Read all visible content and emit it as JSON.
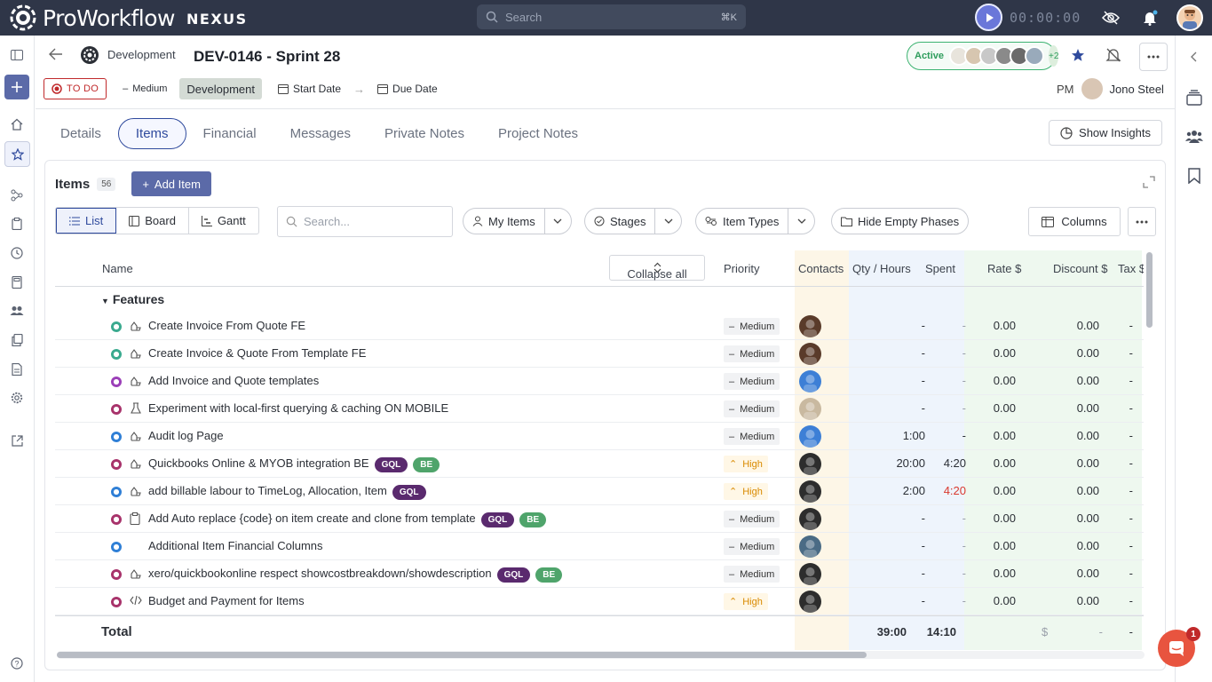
{
  "app": {
    "brand": "ProWorkflow",
    "product": "NEXUS"
  },
  "search": {
    "placeholder": "Search",
    "shortcut": "⌘K"
  },
  "timer": {
    "time": "00:00:00"
  },
  "project": {
    "breadcrumb": "Development",
    "title": "DEV-0146 - Sprint 28",
    "status": "Active",
    "status_extra": "+2",
    "state": "TO DO",
    "priority": "Medium",
    "stage": "Development",
    "start_label": "Start Date",
    "due_label": "Due Date",
    "pm_label": "PM",
    "pm_name": "Jono Steel"
  },
  "tabs": [
    "Details",
    "Items",
    "Financial",
    "Messages",
    "Private Notes",
    "Project Notes"
  ],
  "active_tab": "Items",
  "insights_label": "Show Insights",
  "items": {
    "title": "Items",
    "count": "56",
    "add_label": "Add Item",
    "views": [
      "List",
      "Board",
      "Gantt"
    ],
    "search_placeholder": "Search...",
    "filters": {
      "my_items": "My Items",
      "stages": "Stages",
      "item_types": "Item Types",
      "hide_empty": "Hide Empty Phases"
    },
    "columns_label": "Columns",
    "collapse_label": "Collapse all"
  },
  "table": {
    "headers": {
      "name": "Name",
      "priority": "Priority",
      "contacts": "Contacts",
      "qty": "Qty / Hours",
      "spent": "Spent",
      "rate": "Rate $",
      "discount": "Discount $",
      "tax": "Tax $"
    },
    "section": "Features",
    "rows": [
      {
        "name": "Create Invoice From Quote FE",
        "status_color": "#3aaa8f",
        "type_icon": "feature-icon",
        "tags": [],
        "priority": "Medium",
        "qty": "-",
        "spent": "-",
        "spent_style": "muted",
        "rate": "0.00",
        "discount": "0.00",
        "tax": "-",
        "avatar_color": "#5a3b2a"
      },
      {
        "name": "Create Invoice & Quote From Template FE",
        "status_color": "#3aaa8f",
        "type_icon": "feature-icon",
        "tags": [],
        "priority": "Medium",
        "qty": "-",
        "spent": "-",
        "spent_style": "muted",
        "rate": "0.00",
        "discount": "0.00",
        "tax": "-",
        "avatar_color": "#5a3b2a"
      },
      {
        "name": "Add Invoice and Quote templates",
        "status_color": "#9b3fb8",
        "type_icon": "feature-icon",
        "tags": [],
        "priority": "Medium",
        "qty": "-",
        "spent": "-",
        "spent_style": "muted",
        "rate": "0.00",
        "discount": "0.00",
        "tax": "-",
        "avatar_color": "#3d7fd6"
      },
      {
        "name": "Experiment with local-first querying & caching ON MOBILE",
        "status_color": "#a8336b",
        "type_icon": "flask-icon",
        "tags": [],
        "priority": "Medium",
        "qty": "-",
        "spent": "-",
        "spent_style": "muted",
        "rate": "0.00",
        "discount": "0.00",
        "tax": "-",
        "avatar_color": "#c9b9a0"
      },
      {
        "name": "Audit log Page",
        "status_color": "#2f7fd6",
        "type_icon": "feature-icon",
        "tags": [],
        "priority": "Medium",
        "qty": "1:00",
        "spent": "-",
        "spent_style": "normal",
        "rate": "0.00",
        "discount": "0.00",
        "tax": "-",
        "avatar_color": "#3d7fd6"
      },
      {
        "name": "Quickbooks Online & MYOB integration BE",
        "status_color": "#a8336b",
        "type_icon": "feature-icon",
        "tags": [
          "GQL",
          "BE"
        ],
        "priority": "High",
        "qty": "20:00",
        "spent": "4:20",
        "spent_style": "normal",
        "rate": "0.00",
        "discount": "0.00",
        "tax": "-",
        "avatar_color": "#2d2d2d"
      },
      {
        "name": "add billable labour to TimeLog, Allocation, Item",
        "status_color": "#2f7fd6",
        "type_icon": "feature-icon",
        "tags": [
          "GQL"
        ],
        "priority": "High",
        "qty": "2:00",
        "spent": "4:20",
        "spent_style": "red",
        "rate": "0.00",
        "discount": "0.00",
        "tax": "-",
        "avatar_color": "#2d2d2d"
      },
      {
        "name": "Add Auto replace {code} on item create and clone from template",
        "status_color": "#a8336b",
        "type_icon": "clipboard-icon",
        "tags": [
          "GQL",
          "BE"
        ],
        "priority": "Medium",
        "qty": "-",
        "spent": "-",
        "spent_style": "muted",
        "rate": "0.00",
        "discount": "0.00",
        "tax": "-",
        "avatar_color": "#2d2d2d"
      },
      {
        "name": "Additional Item Financial Columns",
        "status_color": "#2f7fd6",
        "type_icon": "none",
        "tags": [],
        "priority": "Medium",
        "qty": "-",
        "spent": "-",
        "spent_style": "muted",
        "rate": "0.00",
        "discount": "0.00",
        "tax": "-",
        "avatar_color": "#4a6b85"
      },
      {
        "name": "xero/quickbookonline respect showcostbreakdown/showdescription",
        "status_color": "#a8336b",
        "type_icon": "feature-icon",
        "tags": [
          "GQL",
          "BE"
        ],
        "priority": "Medium",
        "qty": "-",
        "spent": "-",
        "spent_style": "muted",
        "rate": "0.00",
        "discount": "0.00",
        "tax": "-",
        "avatar_color": "#2d2d2d"
      },
      {
        "name": "Budget and Payment for Items",
        "status_color": "#a8336b",
        "type_icon": "code-icon",
        "tags": [],
        "priority": "High",
        "qty": "-",
        "spent": "-",
        "spent_style": "muted",
        "rate": "0.00",
        "discount": "0.00",
        "tax": "-",
        "avatar_color": "#2d2d2d"
      }
    ],
    "total": {
      "label": "Total",
      "qty": "39:00",
      "spent": "14:10",
      "discount_symbol": "$",
      "discount": "-",
      "tax": "-"
    }
  },
  "chat_badge": "1"
}
